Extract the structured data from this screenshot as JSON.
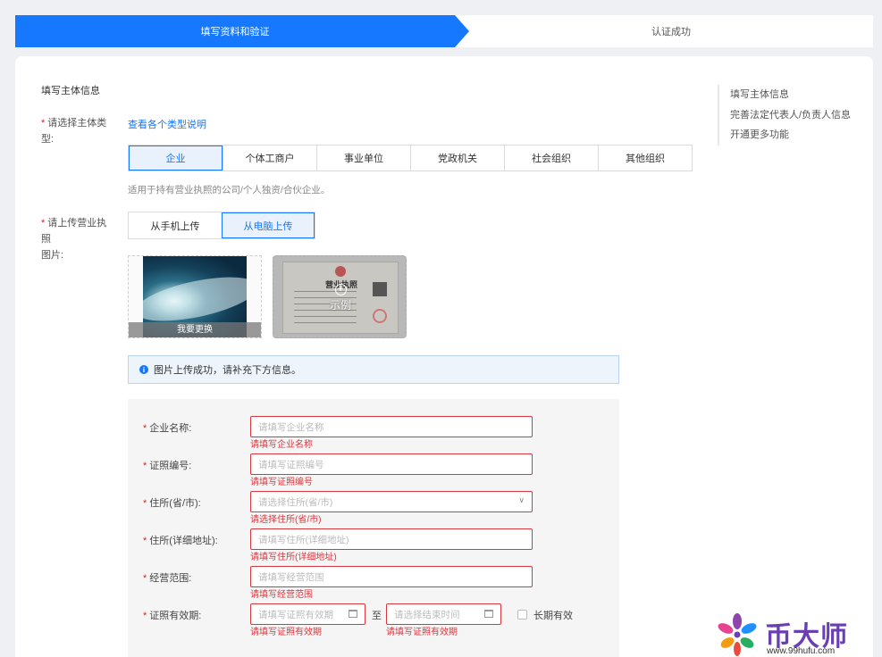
{
  "steps": {
    "active": "填写资料和验证",
    "next": "认证成功"
  },
  "section_title": "填写主体信息",
  "right_nav": [
    "填写主体信息",
    "完善法定代表人/负责人信息",
    "开通更多功能"
  ],
  "entity_type": {
    "label_line1": "请选择主体类",
    "label_line2": "型:",
    "link": "查看各个类型说明",
    "options": [
      "企业",
      "个体工商户",
      "事业单位",
      "党政机关",
      "社会组织",
      "其他组织"
    ],
    "selected": "企业",
    "hint": "适用于持有营业执照的公司/个人独资/合伙企业。"
  },
  "license_upload": {
    "label_line1": "请上传营业执照",
    "label_line2": "图片:",
    "options": [
      "从手机上传",
      "从电脑上传"
    ],
    "selected": "从电脑上传",
    "replace_label": "我要更换",
    "sample_title": "营业执照",
    "sample_label": "示例"
  },
  "info_message": "图片上传成功，请补充下方信息。",
  "form": {
    "company_name": {
      "label": "企业名称:",
      "placeholder": "请填写企业名称",
      "error": "请填写企业名称"
    },
    "license_no": {
      "label": "证照编号:",
      "placeholder": "请填写证照编号",
      "error": "请填写证照编号"
    },
    "province_city": {
      "label": "住所(省/市):",
      "placeholder": "请选择住所(省/市)",
      "error": "请选择住所(省/市)"
    },
    "address_detail": {
      "label": "住所(详细地址):",
      "placeholder": "请填写住所(详细地址)",
      "error": "请填写住所(详细地址)"
    },
    "business_scope": {
      "label": "经营范围:",
      "placeholder": "请填写经营范围",
      "error": "请填写经营范围"
    },
    "validity": {
      "label": "证照有效期:",
      "start_placeholder": "请填写证照有效期",
      "end_placeholder": "请选择结束时间",
      "separator": "至",
      "start_error": "请填写证照有效期",
      "end_error": "请填写证照有效期",
      "long_term_label": "长期有效"
    }
  },
  "watermark": {
    "text": "币大师",
    "url": "www.99hufu.com"
  },
  "colors": {
    "primary": "#1677ff",
    "error": "#d9363e",
    "watermark": "#6a3fb3"
  }
}
